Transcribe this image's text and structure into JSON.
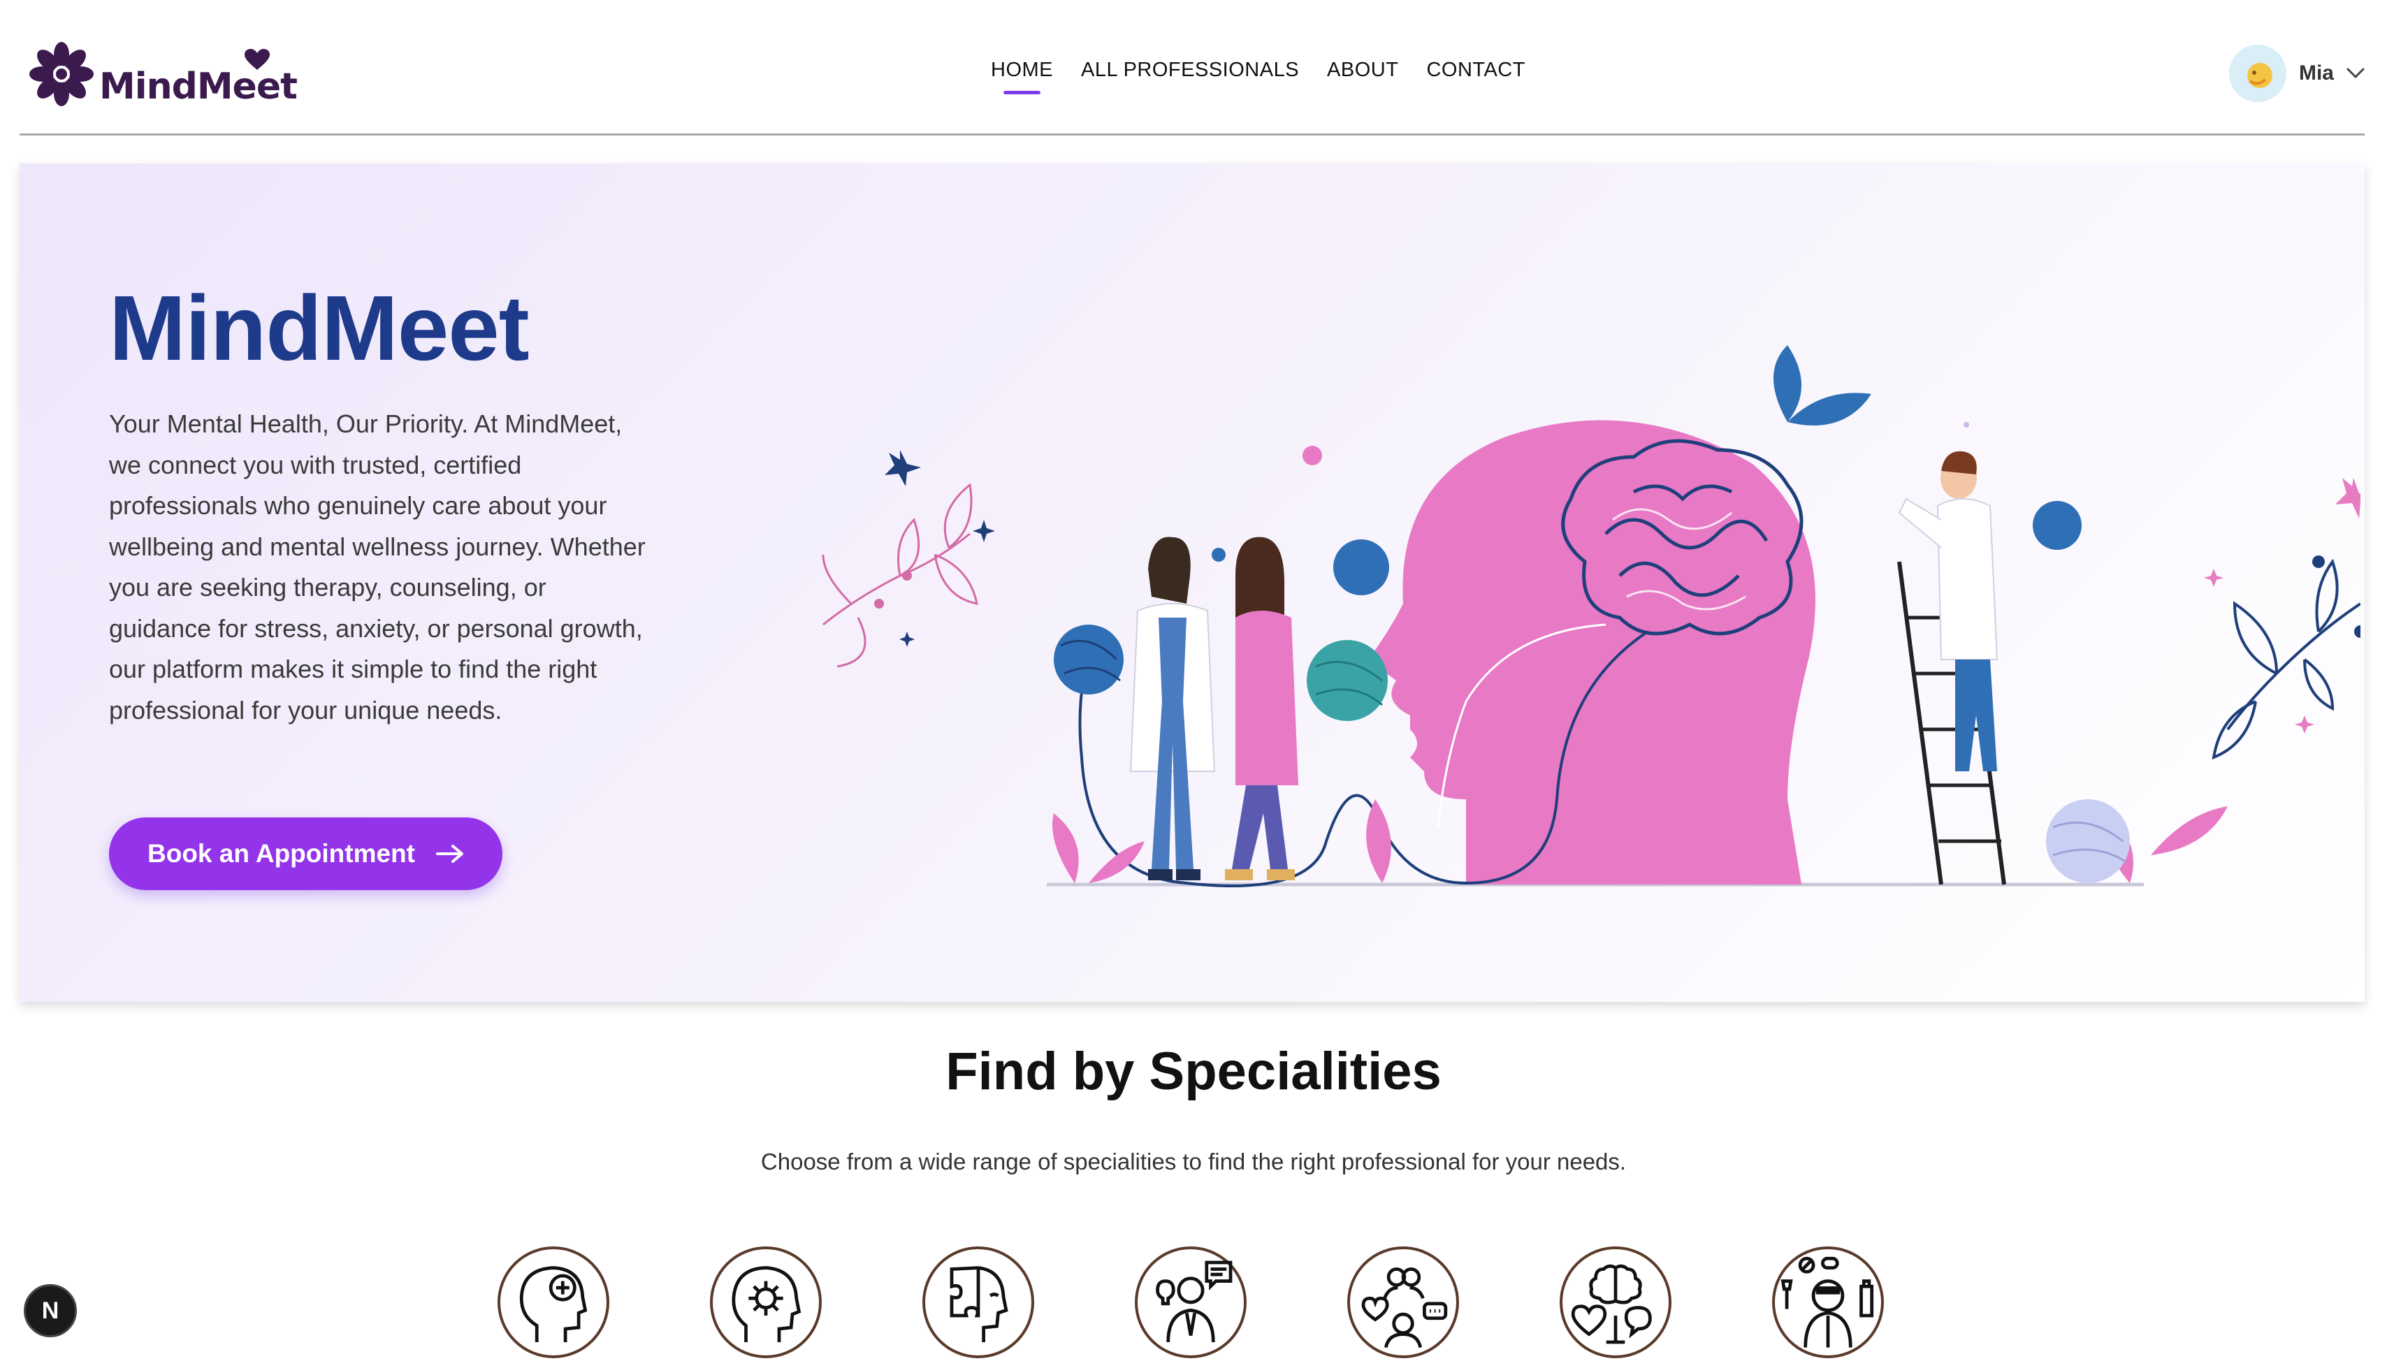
{
  "brand": {
    "name": "MindMeet"
  },
  "nav": {
    "items": [
      {
        "label": "HOME",
        "active": true
      },
      {
        "label": "ALL PROFESSIONALS",
        "active": false
      },
      {
        "label": "ABOUT",
        "active": false
      },
      {
        "label": "CONTACT",
        "active": false
      }
    ]
  },
  "user": {
    "name": "Mia"
  },
  "hero": {
    "title": "MindMeet",
    "description": "Your Mental Health, Our Priority. At MindMeet, we connect you with trusted, certified professionals who genuinely care about your wellbeing and mental wellness journey. Whether you are seeking therapy, counseling, or guidance for stress, anxiety, or personal growth, our platform makes it simple to find the right professional for your unique needs.",
    "cta_label": "Book an Appointment"
  },
  "specialities": {
    "title": "Find by Specialities",
    "subtitle": "Choose from a wide range of specialities to find the right professional for your needs.",
    "icons": [
      "mind-health-icon",
      "mind-gear-icon",
      "puzzle-head-icon",
      "counselor-icon",
      "group-therapy-icon",
      "brain-heart-icon",
      "addiction-icon"
    ]
  },
  "colors": {
    "accent": "#9333ea",
    "nav_underline": "#7c3aed",
    "title_blue": "#1e3a8a",
    "brand_purple": "#3b1a4e",
    "illustration_pink": "#e879c5",
    "illustration_blue": "#2f6fb5"
  },
  "badge": {
    "label": "N"
  }
}
